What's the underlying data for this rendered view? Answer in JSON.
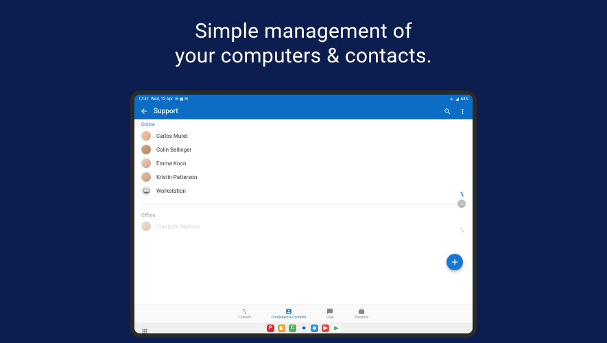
{
  "headline_line1": "Simple management of",
  "headline_line2": "your computers & contacts.",
  "status": {
    "time": "17:41",
    "date": "Wed, 12 Apr",
    "battery": "68%"
  },
  "app_bar": {
    "title": "Support"
  },
  "sections": {
    "online_label": "Online",
    "offline_label": "Offline"
  },
  "contacts": {
    "online": [
      {
        "name": "Carlos Muret"
      },
      {
        "name": "Colin Ballinger"
      },
      {
        "name": "Emma Koon"
      },
      {
        "name": "Kristin Patterson"
      },
      {
        "name": "Workstation"
      }
    ],
    "offline": [
      {
        "name": "Charlotte Walloon"
      }
    ]
  },
  "bottom_nav": {
    "items": [
      {
        "label": "Connect"
      },
      {
        "label": "Computers & Contacts"
      },
      {
        "label": "Chat"
      },
      {
        "label": "Solutions"
      }
    ]
  }
}
